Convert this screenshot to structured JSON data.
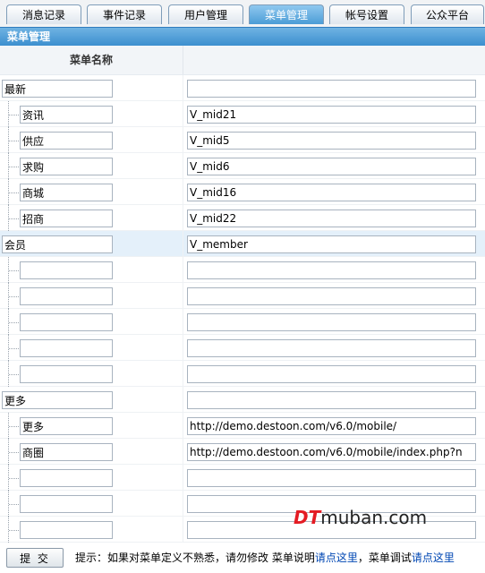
{
  "tabs": [
    {
      "label": "消息记录",
      "active": false
    },
    {
      "label": "事件记录",
      "active": false
    },
    {
      "label": "用户管理",
      "active": false
    },
    {
      "label": "菜单管理",
      "active": true
    },
    {
      "label": "帐号设置",
      "active": false
    },
    {
      "label": "公众平台",
      "active": false
    }
  ],
  "section_title": "菜单管理",
  "table": {
    "header_name": "菜单名称",
    "header_value": "",
    "rows": [
      {
        "level": "parent",
        "name": "最新",
        "value": ""
      },
      {
        "level": "child",
        "name": "资讯",
        "value": "V_mid21"
      },
      {
        "level": "child",
        "name": "供应",
        "value": "V_mid5"
      },
      {
        "level": "child",
        "name": "求购",
        "value": "V_mid6"
      },
      {
        "level": "child",
        "name": "商城",
        "value": "V_mid16"
      },
      {
        "level": "child",
        "name": "招商",
        "value": "V_mid22"
      },
      {
        "level": "parent",
        "name": "会员",
        "value": "V_member",
        "highlight": true
      },
      {
        "level": "child",
        "name": "",
        "value": ""
      },
      {
        "level": "child",
        "name": "",
        "value": ""
      },
      {
        "level": "child",
        "name": "",
        "value": ""
      },
      {
        "level": "child",
        "name": "",
        "value": ""
      },
      {
        "level": "child",
        "name": "",
        "value": ""
      },
      {
        "level": "parent",
        "name": "更多",
        "value": ""
      },
      {
        "level": "child",
        "name": "更多",
        "value": "http://demo.destoon.com/v6.0/mobile/"
      },
      {
        "level": "child",
        "name": "商圈",
        "value": "http://demo.destoon.com/v6.0/mobile/index.php?n"
      },
      {
        "level": "child",
        "name": "",
        "value": ""
      },
      {
        "level": "child",
        "name": "",
        "value": ""
      },
      {
        "level": "child",
        "name": "",
        "value": ""
      }
    ]
  },
  "footer": {
    "submit_label": "提 交",
    "tip_prefix": "提示：如果对菜单定义不熟悉，请勿修改 菜单说明",
    "tip_link1": "请点这里",
    "tip_middle": "，菜单调试",
    "tip_link2": "请点这里"
  },
  "watermark": {
    "part1": "DT",
    "part2": "muban.com"
  },
  "colors": {
    "accent": "#4b9cd6",
    "header_bar": "#3c8fcf",
    "highlight_row": "#e4f0fa",
    "link": "#0047b3"
  }
}
